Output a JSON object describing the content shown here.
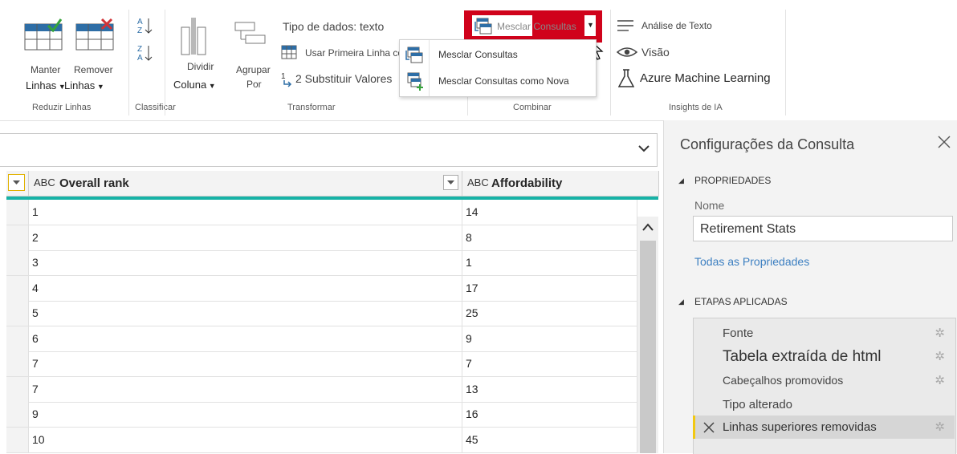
{
  "ribbon": {
    "reduzir_linhas": {
      "manter_line1": "Manter",
      "manter_line2": "Linhas",
      "remover_line1": "Remover",
      "remover_line2": "Linhas",
      "group_label": "Reduzir Linhas"
    },
    "classificar": {
      "group_label": "Classificar"
    },
    "transformar": {
      "dividir_line1": "Dividir",
      "dividir_line2": "Coluna",
      "agrupar_line1": "Agrupar",
      "agrupar_line2": "Por",
      "tipo_dados": "Tipo de dados: texto",
      "usar_primeira_linha": "Usar Primeira Linha co",
      "substituir_valores": "2 Substituir Valores",
      "group_label": "Transformar"
    },
    "combinar": {
      "mesclar_consultas": "Mesclar Consultas",
      "group_label": "Combinar"
    },
    "insights": {
      "analise_texto": "Análise de Texto",
      "visao": "Visão",
      "azure_ml": "Azure Machine Learning",
      "group_label": "Insights de IA"
    }
  },
  "dropdown": {
    "items": [
      "Mesclar Consultas",
      "Mesclar Consultas como Nova"
    ]
  },
  "grid": {
    "type_label": "ABC",
    "columns": [
      "Overall rank",
      "Affordability"
    ],
    "rows": [
      [
        "1",
        "14"
      ],
      [
        "2",
        "8"
      ],
      [
        "3",
        "1"
      ],
      [
        "4",
        "17"
      ],
      [
        "5",
        "25"
      ],
      [
        "6",
        "9"
      ],
      [
        "7",
        "7"
      ],
      [
        "7",
        "13"
      ],
      [
        "9",
        "16"
      ],
      [
        "10",
        "45"
      ]
    ]
  },
  "pane": {
    "title": "Configurações da Consulta",
    "propriedades": "PROPRIEDADES",
    "nome_label": "Nome",
    "nome_value": "Retirement Stats",
    "todas_propriedades": "Todas as Propriedades",
    "etapas": "ETAPAS APLICADAS",
    "steps": [
      "Fonte",
      "Tabela extraída de html",
      "Cabeçalhos promovidos",
      "Tipo alterado",
      "Linhas superiores removidas"
    ]
  },
  "colors": {
    "highlight_red": "#d0021b",
    "teal": "#17b2a6",
    "link_blue": "#3c7fc1"
  }
}
